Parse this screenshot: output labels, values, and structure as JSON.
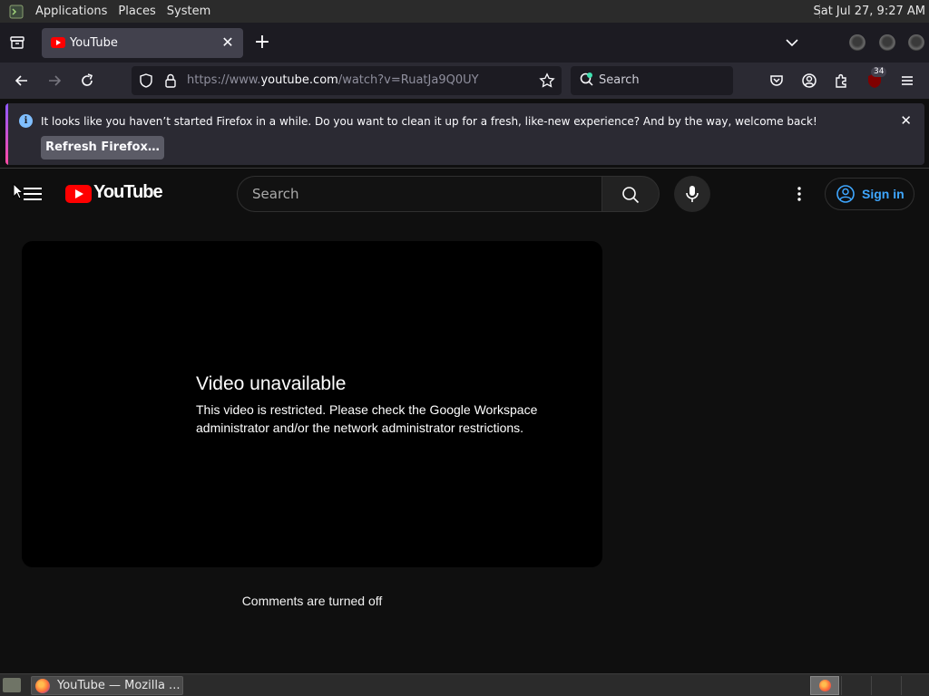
{
  "os_panel": {
    "menus": [
      "Applications",
      "Places",
      "System"
    ],
    "clock": "Sat Jul 27,  9:27 AM"
  },
  "browser": {
    "tab": {
      "title": "YouTube"
    },
    "url": {
      "prefix": "https://www.",
      "domain": "youtube.com",
      "path": "/watch?v=RuatJa9Q0UY"
    },
    "search_placeholder": "Search",
    "extension_badge": "34",
    "notification": {
      "message": "It looks like you haven’t started Firefox in a while. Do you want to clean it up for a fresh, like-new experience? And by the way, welcome back!",
      "button_label": "Refresh Firefox…"
    }
  },
  "youtube": {
    "logo_text": "YouTube",
    "search_placeholder": "Search",
    "sign_in_label": "Sign in",
    "player": {
      "title": "Video unavailable",
      "description": "This video is restricted. Please check the Google Workspace administrator and/or the network administrator restrictions."
    },
    "comments_status": "Comments are turned off"
  },
  "taskbar": {
    "task_label": "YouTube — Mozilla ..."
  },
  "colors": {
    "yt_red": "#ff0000",
    "link_blue": "#3ea6ff",
    "firefox_dark": "#1c1b22",
    "toolbar": "#2b2a33"
  }
}
